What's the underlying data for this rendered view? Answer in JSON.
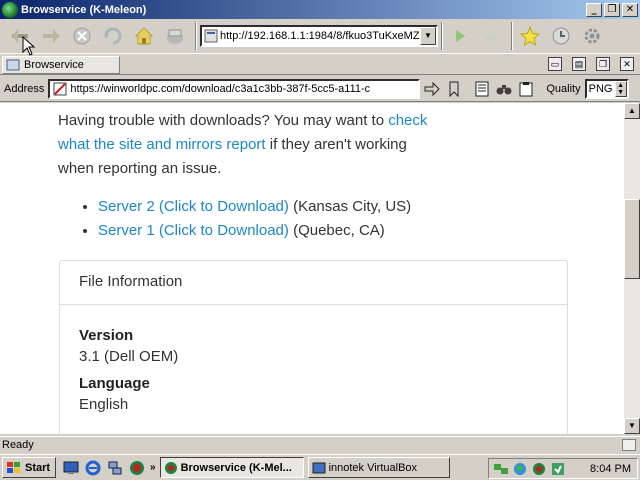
{
  "window": {
    "title": "Browservice (K-Meleon)",
    "minimize_glyph": "_",
    "maximize_glyph": "❐",
    "close_glyph": "✕"
  },
  "toolbar": {
    "url": "http://192.168.1.1:1984/8/fkuo3TuKxeMZ",
    "buttons": [
      "back-icon",
      "forward-icon",
      "stop-icon",
      "reload-icon",
      "home-icon",
      "print-icon",
      "go-icon",
      "up-icon",
      "bookmark-star-icon",
      "history-icon",
      "settings-icon"
    ]
  },
  "tabs": [
    {
      "label": "Browservice"
    }
  ],
  "addressbar": {
    "label": "Address",
    "url": "https://winworldpc.com/download/c3a1c3bb-387f-5cc5-a111-c",
    "quality_label": "Quality",
    "quality_value": "PNG"
  },
  "content": {
    "intro_before": "Having trouble with downloads? You may want to",
    "intro_link": "check what the site and mirrors report",
    "intro_after": " if they aren't working when reporting an issue.",
    "servers": [
      {
        "link": "Server 2 (Click to Download)",
        "location": " (Kansas City, US)"
      },
      {
        "link": "Server 1 (Click to Download)",
        "location": " (Quebec, CA)"
      }
    ],
    "file_info": {
      "heading": "File Information",
      "fields": [
        {
          "label": "Version",
          "value": "3.1 (Dell OEM)"
        },
        {
          "label": "Language",
          "value": "English"
        }
      ]
    }
  },
  "status": {
    "text": "Ready"
  },
  "taskbar": {
    "start_label": "Start",
    "more_glyph": "»",
    "tasks": [
      {
        "label": "Browservice (K-Mel...",
        "active": true
      },
      {
        "label": "innotek VirtualBox",
        "active": false
      }
    ],
    "clock": "8:04 PM"
  },
  "colors": {
    "titlebar_start": "#0a246a",
    "link": "#1b88c7",
    "chrome": "#d4d0c8"
  }
}
